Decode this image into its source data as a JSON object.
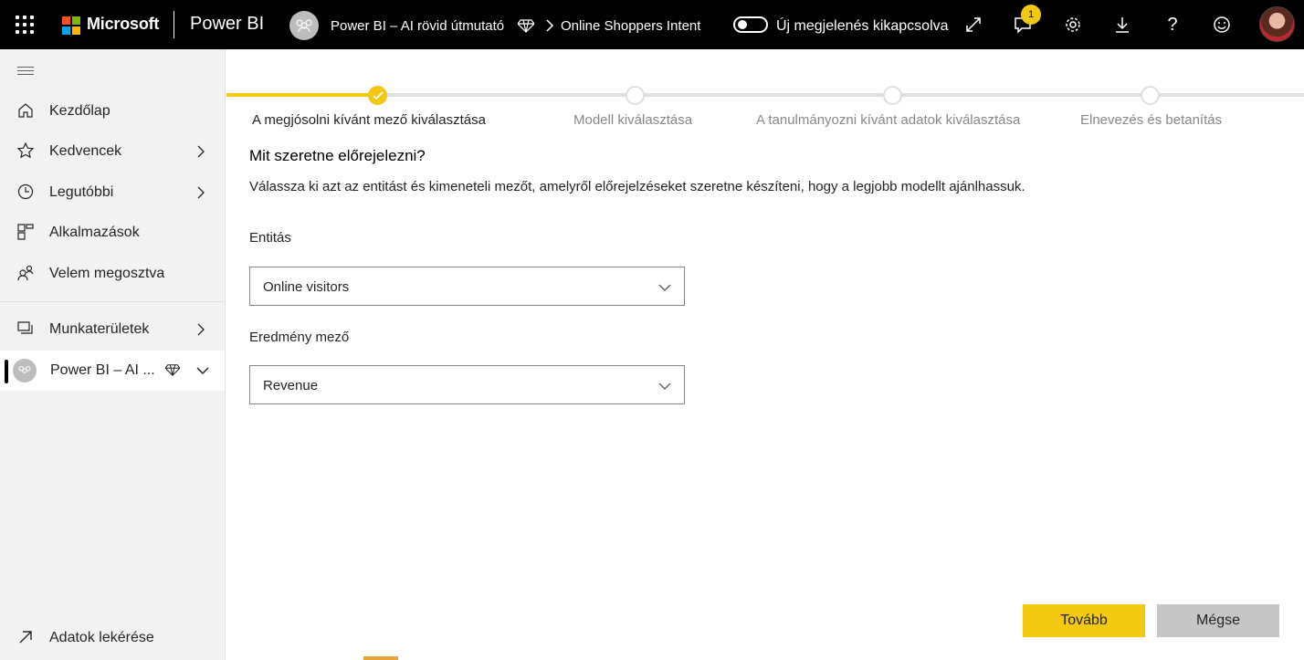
{
  "topbar": {
    "brand": "Microsoft",
    "product": "Power BI",
    "workspace_name": "Power BI – AI rövid útmutató",
    "breadcrumb_item": "Online Shoppers Intent",
    "toggle_label": "Új megjelenés kikapcsolva",
    "notification_count": "1",
    "icons": [
      "app-launcher-icon",
      "expand-icon",
      "notifications-icon",
      "settings-icon",
      "download-icon",
      "help-icon",
      "feedback-icon"
    ]
  },
  "sidebar": {
    "items": [
      {
        "label": "Kezdőlap",
        "icon": "home-icon"
      },
      {
        "label": "Kedvencek",
        "icon": "star-icon"
      },
      {
        "label": "Legutóbbi",
        "icon": "clock-icon"
      },
      {
        "label": "Alkalmazások",
        "icon": "apps-icon"
      },
      {
        "label": "Velem megosztva",
        "icon": "shared-icon"
      },
      {
        "label": "Munkaterületek",
        "icon": "workspaces-icon"
      },
      {
        "label": "Power BI – AI ...",
        "icon": "workspace-avatar-icon"
      }
    ],
    "footer": "Adatok lekérése"
  },
  "stepper": {
    "steps": [
      {
        "label": "A megjósolni kívánt mező kiválasztása",
        "state": "current"
      },
      {
        "label": "Modell kiválasztása",
        "state": "pending"
      },
      {
        "label": "A tanulmányozni kívánt adatok kiválasztása",
        "state": "pending"
      },
      {
        "label": "Elnevezés és betanítás",
        "state": "pending"
      }
    ]
  },
  "main": {
    "heading": "Mit szeretne előrejelezni?",
    "description": "Válassza ki azt az entitást és kimeneteli mezőt, amelyről előrejelzéseket szeretne készíteni, hogy a legjobb modellt ajánlhassuk.",
    "entity_label": "Entitás",
    "entity_value": "Online visitors",
    "outcome_label": "Eredmény mező",
    "outcome_value": "Revenue"
  },
  "buttons": {
    "next": "Tovább",
    "cancel": "Mégse"
  },
  "colors": {
    "accent": "#f2c811",
    "topbar": "#000000",
    "sidebar": "#f3f2f1"
  }
}
